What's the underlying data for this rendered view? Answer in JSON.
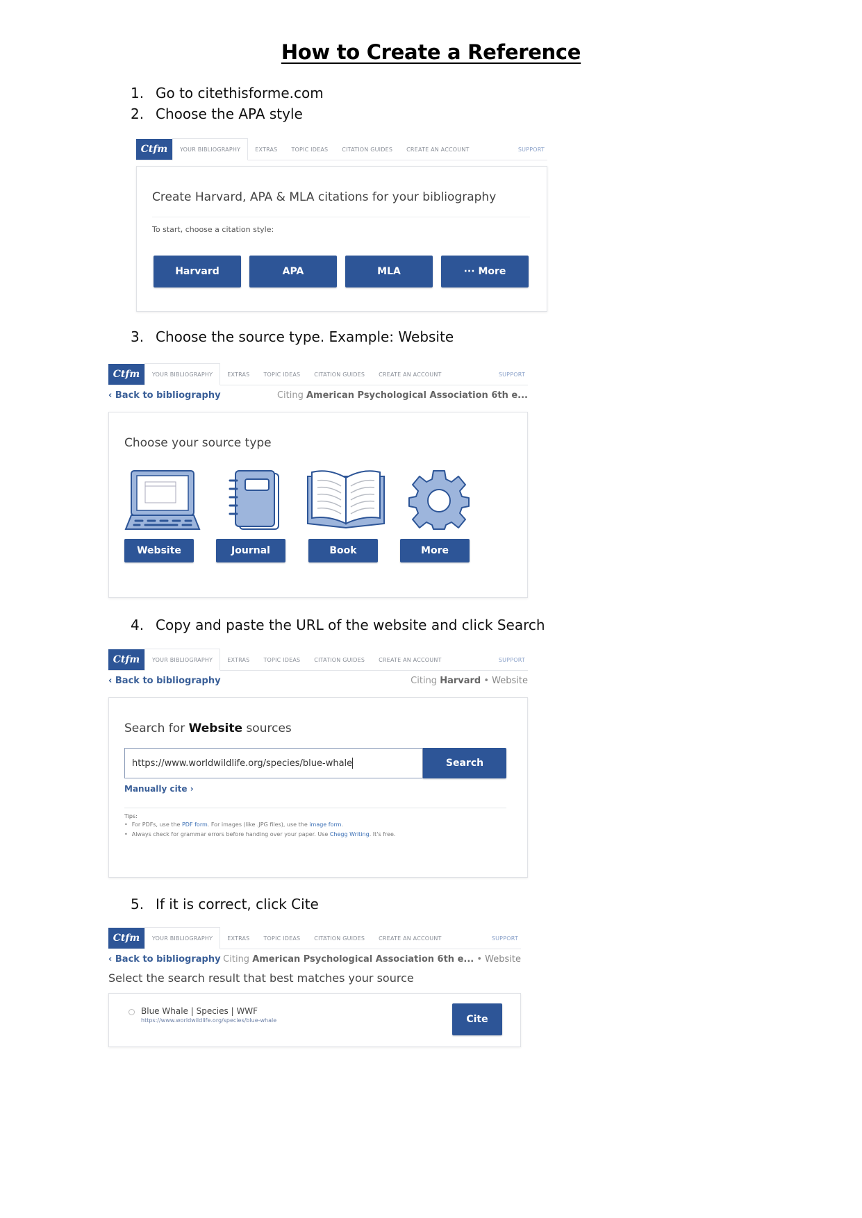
{
  "document": {
    "title": "How to Create a Reference",
    "steps": [
      {
        "number": "1.",
        "text": "Go to citethisforme.com"
      },
      {
        "number": "2.",
        "text": "Choose the APA style"
      },
      {
        "number": "3.",
        "text": "Choose the source type. Example: Website"
      },
      {
        "number": "4.",
        "text": "Copy and paste the URL of the website and click Search"
      },
      {
        "number": "5.",
        "text": "If it is correct, click Cite"
      }
    ]
  },
  "nav": {
    "logo": "Ctfm",
    "tabs": [
      "YOUR BIBLIOGRAPHY",
      "EXTRAS",
      "TOPIC IDEAS",
      "CITATION GUIDES",
      "CREATE AN ACCOUNT"
    ],
    "support": "SUPPORT"
  },
  "shot1": {
    "heading": "Create Harvard, APA & MLA citations for your bibliography",
    "prompt": "To start, choose a citation style:",
    "buttons": [
      "Harvard",
      "APA",
      "MLA",
      "··· More"
    ]
  },
  "shot2": {
    "back": "‹ Back to bibliography",
    "citing_prefix": "Citing",
    "citing_style": "American Psychological Association 6th e...",
    "heading": "Choose your source type",
    "source_types": [
      {
        "icon": "laptop-icon",
        "label": "Website"
      },
      {
        "icon": "notebook-icon",
        "label": "Journal"
      },
      {
        "icon": "open-book-icon",
        "label": "Book"
      },
      {
        "icon": "gear-icon",
        "label": "More"
      }
    ]
  },
  "shot3": {
    "back": "‹ Back to bibliography",
    "citing_prefix": "Citing",
    "citing_style": "Harvard",
    "citing_type": "• Website",
    "heading_prefix": "Search for",
    "heading_bold": "Website",
    "heading_suffix": "sources",
    "search_value": "https://www.worldwildlife.org/species/blue-whale",
    "search_button": "Search",
    "manual_cite": "Manually cite ›",
    "tips_label": "Tips:",
    "tip1_a": "For PDFs, use the ",
    "tip1_link1": "PDF form",
    "tip1_b": ". For images (like .JPG files), use the ",
    "tip1_link2": "image form",
    "tip1_c": ".",
    "tip2_a": "Always check for grammar errors before handing over your paper. Use ",
    "tip2_link": "Chegg Writing",
    "tip2_b": ". It's free."
  },
  "shot4": {
    "back": "‹ Back to bibliography",
    "citing_prefix": "Citing",
    "citing_style": "American Psychological Association 6th e...",
    "citing_type": "• Website",
    "heading": "Select the search result that best matches your source",
    "result_title": "Blue Whale | Species | WWF",
    "result_url": "https://www.worldwildlife.org/species/blue-whale",
    "cite_button": "Cite"
  },
  "colors": {
    "brand_blue": "#2d5597",
    "link_blue": "#3a5f98"
  }
}
